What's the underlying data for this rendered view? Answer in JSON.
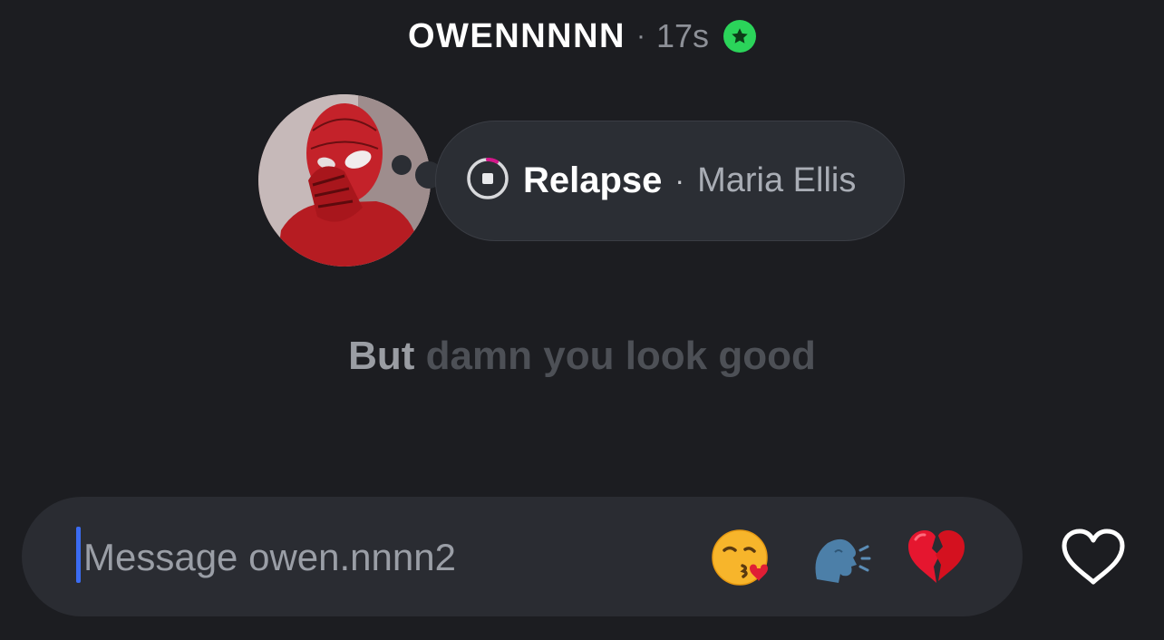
{
  "header": {
    "username": "OWENNNNN",
    "separator": "·",
    "timestamp": "17s",
    "status_color": "#2bd45a"
  },
  "note": {
    "song_title": "Relapse",
    "separator": "·",
    "artist": "Maria Ellis",
    "playback_icon": "playing-stop-icon"
  },
  "lyric": {
    "current": "But",
    "upcoming": "damn you look good"
  },
  "composer": {
    "placeholder": "Message owen.nnnn2",
    "quick_reactions": [
      "kissing-face-blowing-heart-icon",
      "speaking-head-icon",
      "broken-heart-icon"
    ],
    "like_icon": "heart-outline-icon",
    "cursor_color": "#3b6cf2"
  },
  "colors": {
    "background": "#1c1d21",
    "bubble": "#2b2e34",
    "composer": "#2a2c32"
  }
}
